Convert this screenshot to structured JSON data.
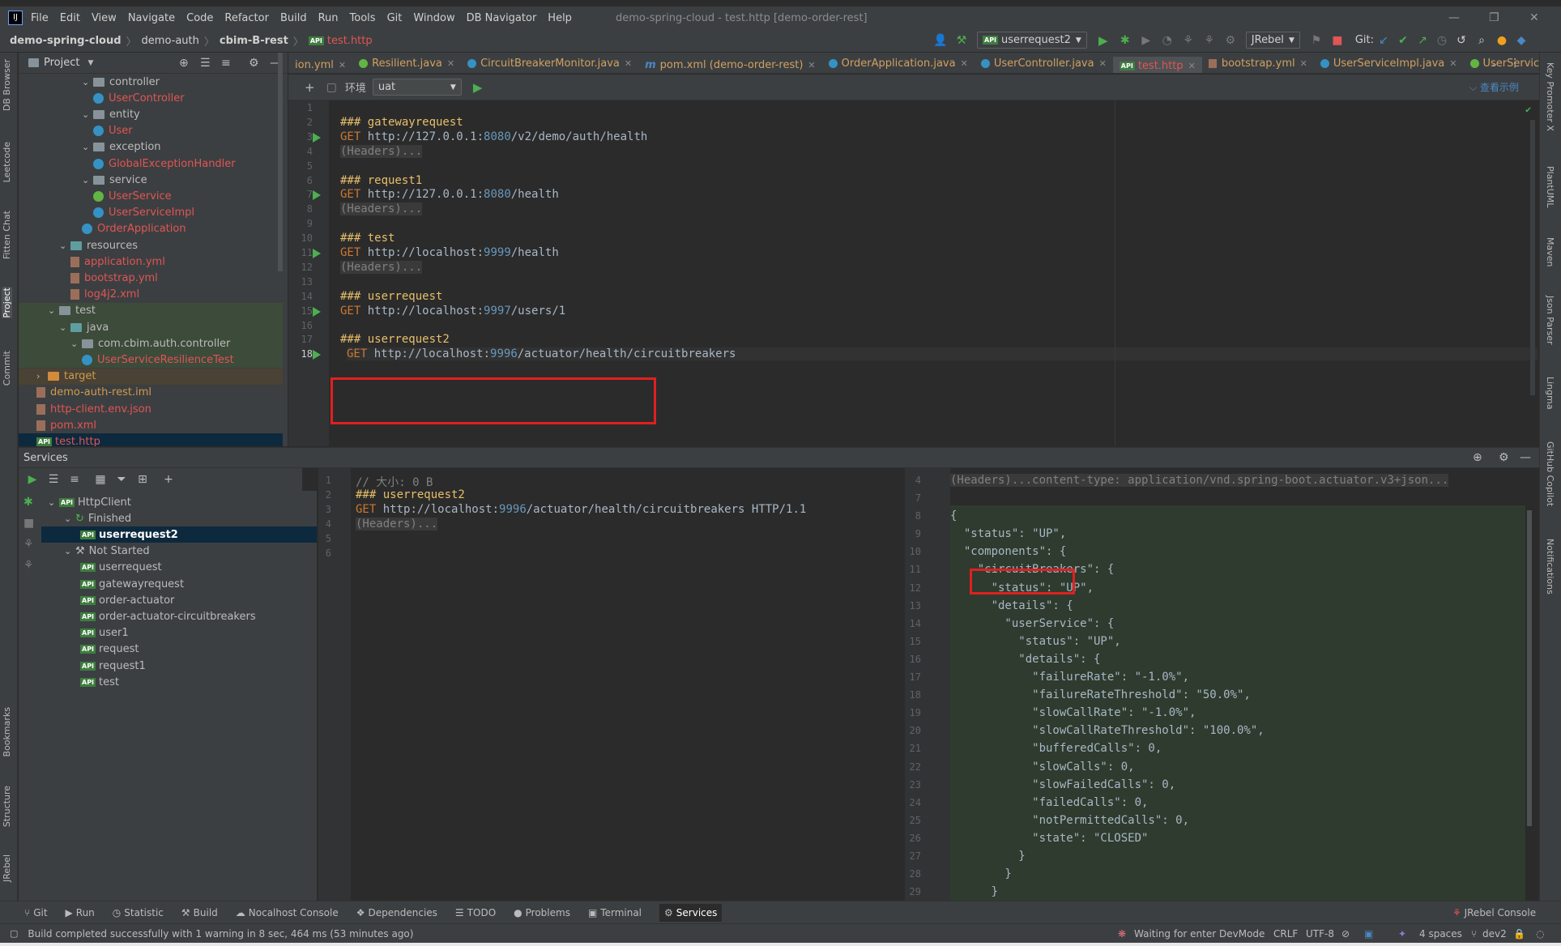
{
  "menu": {
    "items": [
      "File",
      "Edit",
      "View",
      "Navigate",
      "Code",
      "Refactor",
      "Build",
      "Run",
      "Tools",
      "Git",
      "Window",
      "DB Navigator",
      "Help"
    ],
    "window_title": "demo-spring-cloud - test.http [demo-order-rest]"
  },
  "breadcrumb": [
    "demo-spring-cloud",
    "demo-auth",
    "cbim-B-rest",
    "test.http"
  ],
  "toolbar": {
    "run_config": "userrequest2",
    "jrebel": "JRebel",
    "git_label": "Git:"
  },
  "left_strip": [
    "DB Browser",
    "Leetcode",
    "Fitten Chat",
    "Project",
    "Commit",
    "Bookmarks",
    "Structure",
    "JRebel"
  ],
  "right_strip": [
    "Key Promoter X",
    "PlantUML",
    "Maven",
    "Json Parser",
    "Lingma",
    "GitHub Copilot",
    "Notifications"
  ],
  "project": {
    "title": "Project",
    "tree": [
      {
        "label": "controller",
        "kind": "folder",
        "depth": 5
      },
      {
        "label": "UserController",
        "kind": "class",
        "depth": 6,
        "color": "red"
      },
      {
        "label": "entity",
        "kind": "folder",
        "depth": 5
      },
      {
        "label": "User",
        "kind": "class",
        "depth": 6,
        "color": "red"
      },
      {
        "label": "exception",
        "kind": "folder",
        "depth": 5
      },
      {
        "label": "GlobalExceptionHandler",
        "kind": "class",
        "depth": 6,
        "color": "red"
      },
      {
        "label": "service",
        "kind": "folder",
        "depth": 5
      },
      {
        "label": "UserService",
        "kind": "iface",
        "depth": 6,
        "color": "red"
      },
      {
        "label": "UserServiceImpl",
        "kind": "class",
        "depth": 6,
        "color": "red"
      },
      {
        "label": "OrderApplication",
        "kind": "class",
        "depth": 5,
        "color": "red"
      },
      {
        "label": "resources",
        "kind": "folder",
        "depth": 3
      },
      {
        "label": "application.yml",
        "kind": "file",
        "depth": 4,
        "color": "red"
      },
      {
        "label": "bootstrap.yml",
        "kind": "file",
        "depth": 4,
        "color": "red"
      },
      {
        "label": "log4j2.xml",
        "kind": "file",
        "depth": 4,
        "color": "red"
      },
      {
        "label": "test",
        "kind": "folder",
        "depth": 2
      },
      {
        "label": "java",
        "kind": "folder",
        "depth": 3
      },
      {
        "label": "com.cbim.auth.controller",
        "kind": "folder",
        "depth": 4
      },
      {
        "label": "UserServiceResilienceTest",
        "kind": "class",
        "depth": 5,
        "color": "red"
      },
      {
        "label": "target",
        "kind": "folder",
        "depth": 1,
        "color": "orange"
      },
      {
        "label": "demo-auth-rest.iml",
        "kind": "file",
        "depth": 1,
        "color": "orange"
      },
      {
        "label": "http-client.env.json",
        "kind": "file",
        "depth": 1,
        "color": "red"
      },
      {
        "label": "pom.xml",
        "kind": "file",
        "depth": 1,
        "color": "red"
      },
      {
        "label": "test.http",
        "kind": "api",
        "depth": 1,
        "color": "red"
      }
    ]
  },
  "tabs": [
    {
      "label": "ion.yml"
    },
    {
      "label": "Resilient.java"
    },
    {
      "label": "CircuitBreakerMonitor.java"
    },
    {
      "label": "pom.xml (demo-order-rest)"
    },
    {
      "label": "OrderApplication.java"
    },
    {
      "label": "UserController.java"
    },
    {
      "label": "test.http",
      "active": true
    },
    {
      "label": "bootstrap.yml"
    },
    {
      "label": "UserServiceImpl.java"
    },
    {
      "label": "UserService.java"
    }
  ],
  "env": {
    "label": "环境",
    "value": "uat",
    "examples": "查看示例"
  },
  "editor": {
    "lines": [
      {
        "n": "1",
        "kind": "blank"
      },
      {
        "n": "2",
        "kind": "name",
        "text": "### gatewayrequest"
      },
      {
        "n": "3",
        "kind": "get",
        "method": "GET",
        "host": "http://127.0.0.1:",
        "port": "8080",
        "path": "/v2/demo/auth/health"
      },
      {
        "n": "4",
        "kind": "fold",
        "text": "(Headers)..."
      },
      {
        "n": "5",
        "kind": "blank"
      },
      {
        "n": "6",
        "kind": "name",
        "text": "### request1"
      },
      {
        "n": "7",
        "kind": "get",
        "method": "GET",
        "host": "http://127.0.0.1:",
        "port": "8080",
        "path": "/health"
      },
      {
        "n": "8",
        "kind": "fold",
        "text": "(Headers)..."
      },
      {
        "n": "9",
        "kind": "blank"
      },
      {
        "n": "10",
        "kind": "name",
        "text": "### test"
      },
      {
        "n": "11",
        "kind": "get",
        "method": "GET",
        "host": "http://localhost:",
        "port": "9999",
        "path": "/health"
      },
      {
        "n": "12",
        "kind": "fold",
        "text": "(Headers)..."
      },
      {
        "n": "13",
        "kind": "blank"
      },
      {
        "n": "14",
        "kind": "name",
        "text": "### userrequest"
      },
      {
        "n": "15",
        "kind": "get",
        "method": "GET",
        "host": "http://localhost:",
        "port": "9997",
        "path": "/users/1"
      },
      {
        "n": "16",
        "kind": "blank"
      },
      {
        "n": "17",
        "kind": "name",
        "text": "### userrequest2"
      },
      {
        "n": "18",
        "kind": "get",
        "method": "GET",
        "host": "http://localhost:",
        "port": "9996",
        "path": "/actuator/health/circuitbreakers"
      }
    ]
  },
  "services": {
    "title": "Services",
    "tree": [
      {
        "label": "HttpClient",
        "depth": 0,
        "kind": "api"
      },
      {
        "label": "Finished",
        "depth": 1,
        "kind": "group"
      },
      {
        "label": "userrequest2",
        "depth": 2,
        "kind": "api",
        "selected": true
      },
      {
        "label": "Not Started",
        "depth": 1,
        "kind": "group"
      },
      {
        "label": "userrequest",
        "depth": 2,
        "kind": "api"
      },
      {
        "label": "gatewayrequest",
        "depth": 2,
        "kind": "api"
      },
      {
        "label": "order-actuator",
        "depth": 2,
        "kind": "api"
      },
      {
        "label": "order-actuator-circuitbreakers",
        "depth": 2,
        "kind": "api"
      },
      {
        "label": "user1",
        "depth": 2,
        "kind": "api"
      },
      {
        "label": "request",
        "depth": 2,
        "kind": "api"
      },
      {
        "label": "request1",
        "depth": 2,
        "kind": "api"
      },
      {
        "label": "test",
        "depth": 2,
        "kind": "api"
      }
    ]
  },
  "request": {
    "lines": [
      {
        "n": "1",
        "text": "// 大小: 0 B",
        "kind": "comment"
      },
      {
        "n": "2",
        "text": "### userrequest2",
        "kind": "name"
      },
      {
        "n": "3",
        "kind": "get",
        "method": "GET",
        "host": "http://localhost:",
        "port": "9996",
        "path": "/actuator/health/circuitbreakers HTTP/1.1"
      },
      {
        "n": "4",
        "text": "(Headers)...",
        "kind": "fold"
      },
      {
        "n": "5",
        "kind": "blank"
      },
      {
        "n": "6",
        "kind": "blank"
      }
    ]
  },
  "response": {
    "header_line": {
      "n": "4",
      "text": "(Headers)...content-type: application/vnd.spring-boot.actuator.v3+json..."
    },
    "lines": [
      {
        "n": "7",
        "text": ""
      },
      {
        "n": "8",
        "text": "{"
      },
      {
        "n": "9",
        "text": "  \"status\": \"UP\","
      },
      {
        "n": "10",
        "text": "  \"components\": {"
      },
      {
        "n": "11",
        "text": "    \"circuitBreakers\": {"
      },
      {
        "n": "12",
        "text": "      \"status\": \"UP\","
      },
      {
        "n": "13",
        "text": "      \"details\": {"
      },
      {
        "n": "14",
        "text": "        \"userService\": {"
      },
      {
        "n": "15",
        "text": "          \"status\": \"UP\","
      },
      {
        "n": "16",
        "text": "          \"details\": {"
      },
      {
        "n": "17",
        "text": "            \"failureRate\": \"-1.0%\","
      },
      {
        "n": "18",
        "text": "            \"failureRateThreshold\": \"50.0%\","
      },
      {
        "n": "19",
        "text": "            \"slowCallRate\": \"-1.0%\","
      },
      {
        "n": "20",
        "text": "            \"slowCallRateThreshold\": \"100.0%\","
      },
      {
        "n": "21",
        "text": "            \"bufferedCalls\": 0,"
      },
      {
        "n": "22",
        "text": "            \"slowCalls\": 0,"
      },
      {
        "n": "23",
        "text": "            \"slowFailedCalls\": 0,"
      },
      {
        "n": "24",
        "text": "            \"failedCalls\": 0,"
      },
      {
        "n": "25",
        "text": "            \"notPermittedCalls\": 0,"
      },
      {
        "n": "26",
        "text": "            \"state\": \"CLOSED\""
      },
      {
        "n": "27",
        "text": "          }"
      },
      {
        "n": "28",
        "text": "        }"
      },
      {
        "n": "29",
        "text": "      }"
      }
    ]
  },
  "bottom_tools": [
    {
      "label": "Git",
      "icon": "git-icon"
    },
    {
      "label": "Run",
      "icon": "run-icon"
    },
    {
      "label": "Statistic",
      "icon": "statistic-icon"
    },
    {
      "label": "Build",
      "icon": "build-icon"
    },
    {
      "label": "Nocalhost Console",
      "icon": "nocalhost-icon"
    },
    {
      "label": "Dependencies",
      "icon": "dependencies-icon"
    },
    {
      "label": "TODO",
      "icon": "todo-icon"
    },
    {
      "label": "Problems",
      "icon": "problems-icon"
    },
    {
      "label": "Terminal",
      "icon": "terminal-icon"
    },
    {
      "label": "Services",
      "icon": "services-icon",
      "active": true
    }
  ],
  "jrebel_console": "JRebel Console",
  "status": {
    "message": "Build completed successfully with 1 warning in 8 sec, 464 ms (53 minutes ago)",
    "devmode": "Waiting for enter DevMode",
    "line_sep": "CRLF",
    "encoding": "UTF-8",
    "indent": "4 spaces",
    "branch": "dev2"
  },
  "colors": {
    "accent": "#4a88c7",
    "highlight": "#e02020",
    "run": "#4caf50"
  }
}
